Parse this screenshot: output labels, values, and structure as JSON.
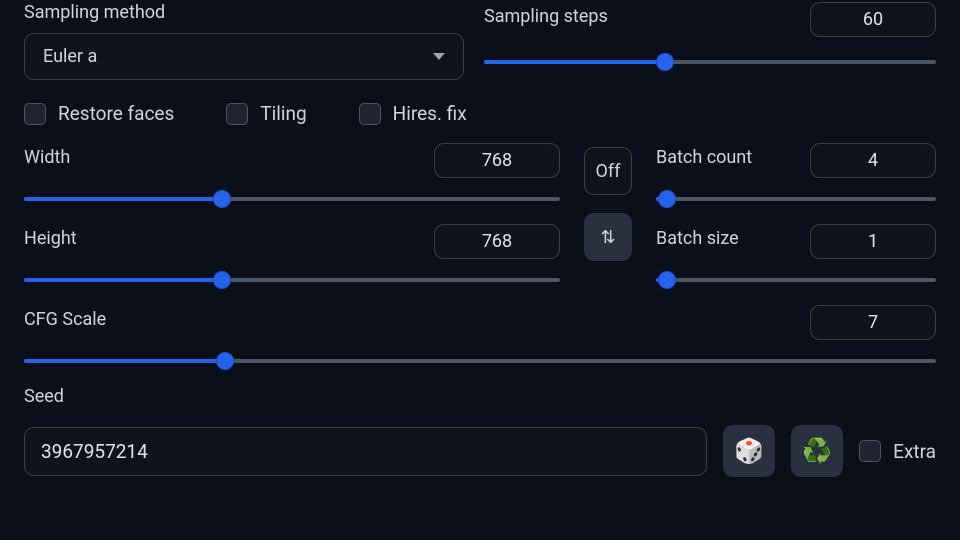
{
  "sampling_method": {
    "label": "Sampling method",
    "value": "Euler a"
  },
  "sampling_steps": {
    "label": "Sampling steps",
    "value": 60,
    "fill_pct": 40
  },
  "checkboxes": {
    "restore_faces": "Restore faces",
    "tiling": "Tiling",
    "hires_fix": "Hires. fix"
  },
  "width": {
    "label": "Width",
    "value": 768,
    "fill_pct": 37
  },
  "height": {
    "label": "Height",
    "value": 768,
    "fill_pct": 37
  },
  "off_button": "Off",
  "batch_count": {
    "label": "Batch count",
    "value": 4,
    "fill_pct": 4
  },
  "batch_size": {
    "label": "Batch size",
    "value": 1,
    "fill_pct": 4
  },
  "cfg_scale": {
    "label": "CFG Scale",
    "value": 7,
    "fill_pct": 22
  },
  "seed": {
    "label": "Seed",
    "value": "3967957214",
    "extra_label": "Extra"
  }
}
